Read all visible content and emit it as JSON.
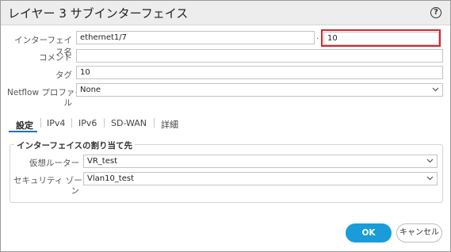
{
  "dialog": {
    "title": "レイヤー 3 サブインターフェイス",
    "help_icon": "?"
  },
  "form": {
    "interface_name_label": "インターフェイス名",
    "interface_name_value": "ethernet1/7",
    "separator": ".",
    "subinterface_value": "10",
    "comment_label": "コメント",
    "comment_value": "",
    "tag_label": "タグ",
    "tag_value": "10",
    "netflow_label_line1": "Netflow プロファイ",
    "netflow_label_line2": "ル",
    "netflow_value": "None"
  },
  "tabs": [
    "設定",
    "IPv4",
    "IPv6",
    "SD-WAN",
    "詳細"
  ],
  "assignment": {
    "group_title": "インターフェイスの割り当て先",
    "virtual_router_label": "仮想ルーター",
    "virtual_router_value": "VR_test",
    "security_zone_label_line1": "セキュリティ ゾー",
    "security_zone_label_line2": "ン",
    "security_zone_value": "Vlan10_test"
  },
  "buttons": {
    "ok": "OK",
    "cancel": "キャンセル"
  },
  "colors": {
    "accent": "#1a9cd8",
    "highlight": "#d9262b",
    "tab_underline": "#1a73c8"
  }
}
